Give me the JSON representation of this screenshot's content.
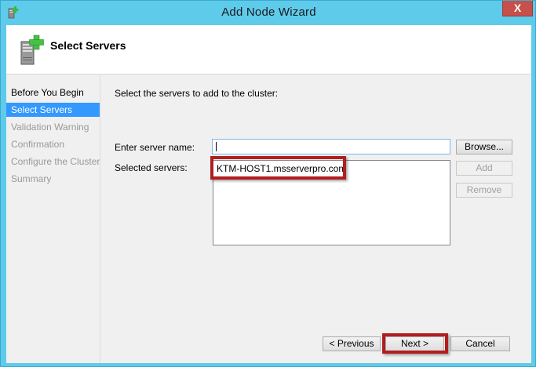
{
  "window": {
    "title": "Add Node Wizard",
    "close_label": "X"
  },
  "header": {
    "title": "Select Servers"
  },
  "nav": {
    "items": [
      {
        "label": "Before You Begin",
        "state": "done"
      },
      {
        "label": "Select Servers",
        "state": "active"
      },
      {
        "label": "Validation Warning",
        "state": "pending"
      },
      {
        "label": "Confirmation",
        "state": "pending"
      },
      {
        "label": "Configure the Cluster",
        "state": "pending"
      },
      {
        "label": "Summary",
        "state": "pending"
      }
    ]
  },
  "main": {
    "prompt": "Select the servers to add to the cluster:",
    "server_name_label": "Enter server name:",
    "server_name_value": "",
    "selected_servers_label": "Selected servers:",
    "selected_servers": [
      "KTM-HOST1.msserverpro.com"
    ],
    "browse_label": "Browse...",
    "add_label": "Add",
    "remove_label": "Remove"
  },
  "footer": {
    "previous_label": "< Previous",
    "next_label": "Next >",
    "cancel_label": "Cancel"
  },
  "colors": {
    "window_frame": "#5fcbeb",
    "selection": "#3399ff",
    "annotation": "#b01e1e",
    "close_button": "#c7504a"
  },
  "icons": {
    "title": "add-node-icon",
    "header": "server-add-icon"
  }
}
